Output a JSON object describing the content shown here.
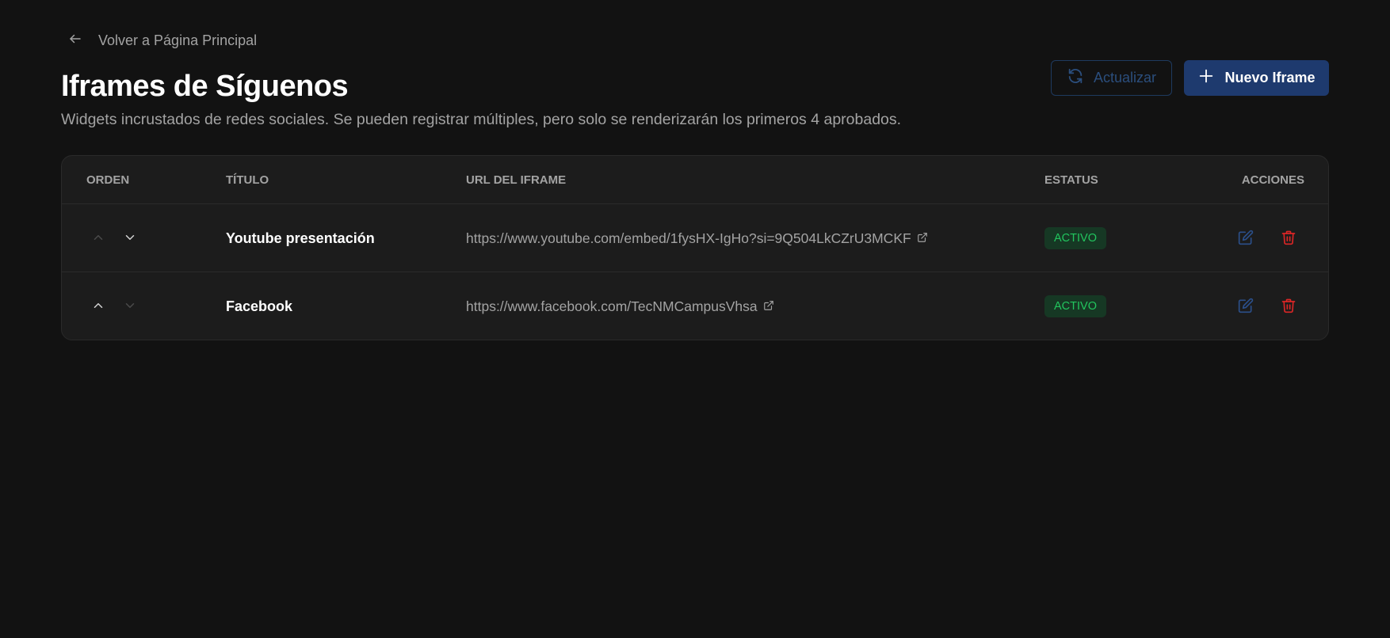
{
  "back_link": {
    "label": "Volver a Página Principal",
    "icon": "arrow-left-icon"
  },
  "header": {
    "title": "Iframes de Síguenos",
    "subtitle": "Widgets incrustados de redes sociales. Se pueden registrar múltiples, pero solo se renderizarán los primeros 4 aprobados."
  },
  "toolbar": {
    "refresh_label": "Actualizar",
    "refresh_icon": "refresh-icon",
    "new_label": "Nuevo Iframe",
    "new_icon": "plus-icon"
  },
  "table": {
    "columns": [
      "ORDEN",
      "TÍTULO",
      "URL DEL IFRAME",
      "ESTATUS",
      "ACCIONES"
    ],
    "rows": [
      {
        "title": "Youtube presentación",
        "url": "https://www.youtube.com/embed/1fysHX-IgHo?si=9Q504LkCZrU3MCKF",
        "status": "ACTIVO",
        "can_move_up": false,
        "can_move_down": true
      },
      {
        "title": "Facebook",
        "url": "https://www.facebook.com/TecNMCampusVhsa",
        "status": "ACTIVO",
        "can_move_up": true,
        "can_move_down": false
      }
    ]
  },
  "colors": {
    "background": "#121212",
    "card": "#1c1c1c",
    "primary_button": "#1e3a6e",
    "status_active_text": "#22c55e",
    "status_active_bg": "#163824",
    "edit_icon": "#2b4f8a",
    "delete_icon": "#dc2626"
  }
}
